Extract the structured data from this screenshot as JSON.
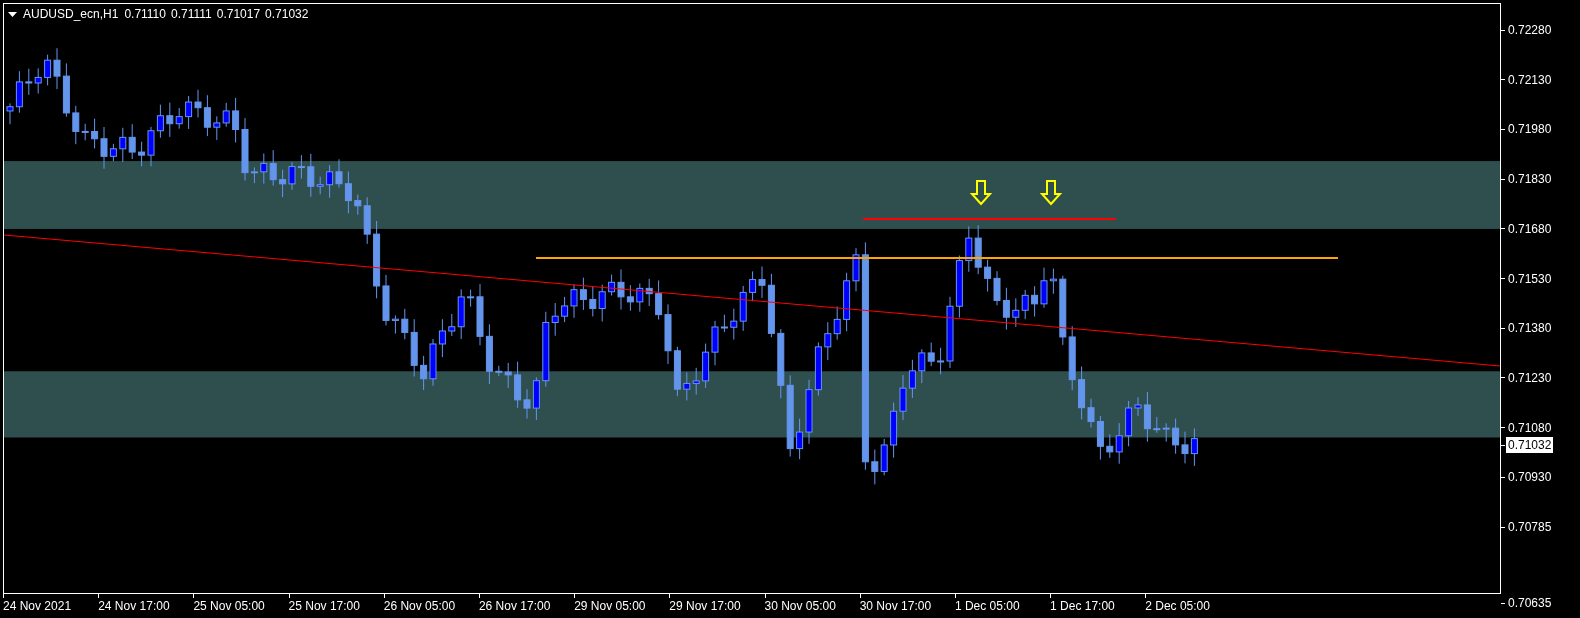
{
  "chart_header": {
    "symbol": "AUDUSD_ecn,H1",
    "quotes": [
      "0.71110",
      "0.71111",
      "0.71017",
      "0.71032"
    ]
  },
  "price_axis": {
    "labels": [
      "0.72280",
      "0.72130",
      "0.71980",
      "0.71830",
      "0.71680",
      "0.71530",
      "0.71380",
      "0.71230",
      "0.71080",
      "0.70930",
      "0.70785",
      "0.70635"
    ],
    "current_price": "0.71032"
  },
  "time_axis": {
    "labels": [
      "24 Nov 2021",
      "24 Nov 17:00",
      "25 Nov 05:00",
      "25 Nov 17:00",
      "26 Nov 05:00",
      "26 Nov 17:00",
      "29 Nov 05:00",
      "29 Nov 17:00",
      "30 Nov 05:00",
      "30 Nov 17:00",
      "1 Dec 05:00",
      "1 Dec 17:00",
      "2 Dec 05:00"
    ]
  }
}
